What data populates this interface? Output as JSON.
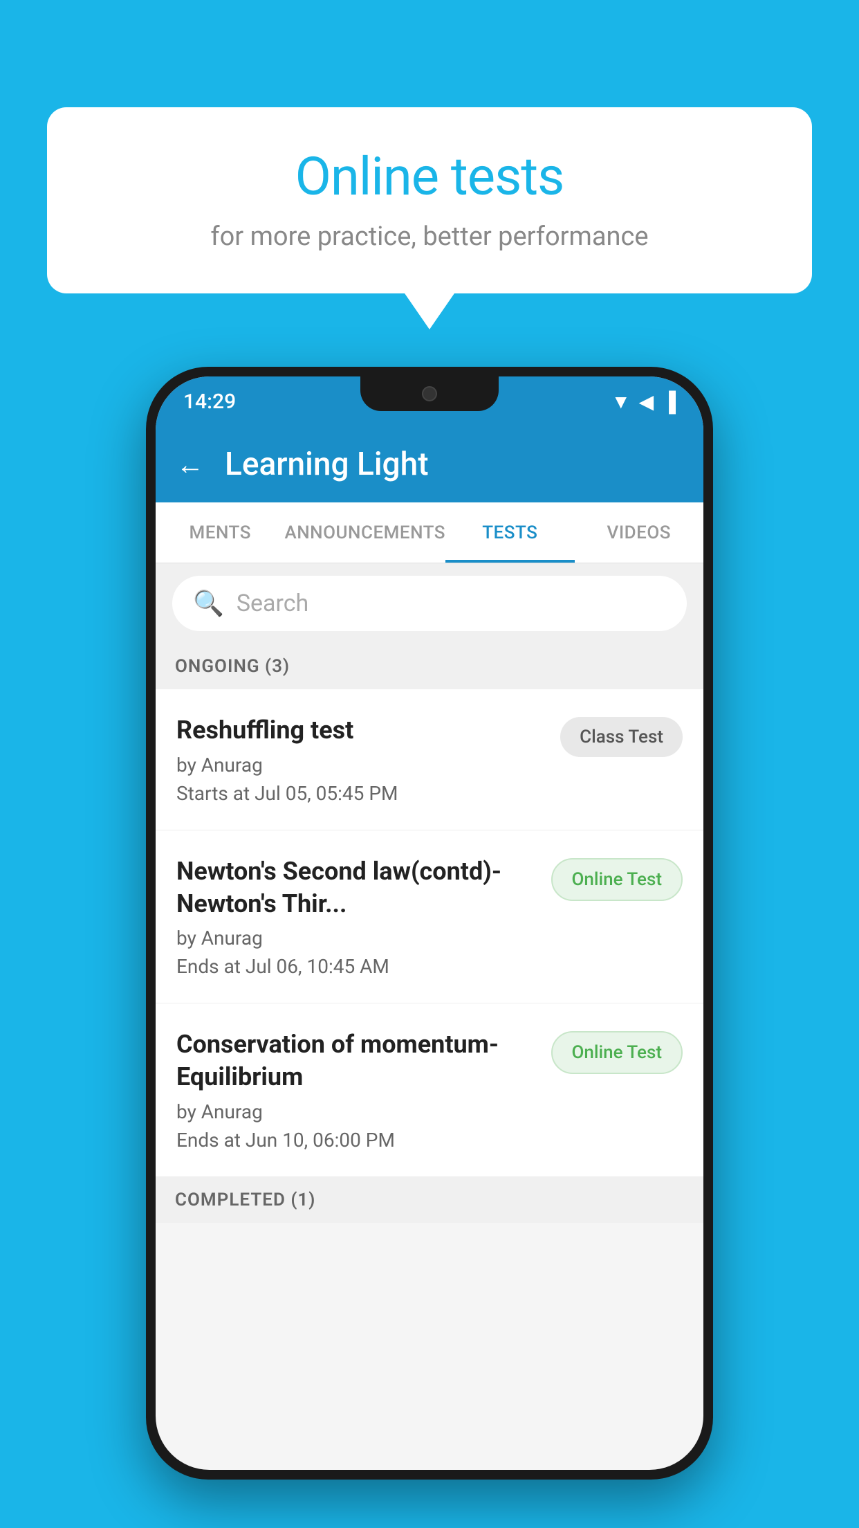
{
  "background_color": "#1AB5E8",
  "bubble": {
    "title": "Online tests",
    "subtitle": "for more practice, better performance"
  },
  "phone": {
    "status_bar": {
      "time": "14:29",
      "icons": [
        "wifi",
        "signal",
        "battery"
      ]
    },
    "app_bar": {
      "title": "Learning Light",
      "back_label": "←"
    },
    "tabs": [
      {
        "label": "MENTS",
        "active": false
      },
      {
        "label": "ANNOUNCEMENTS",
        "active": false
      },
      {
        "label": "TESTS",
        "active": true
      },
      {
        "label": "VIDEOS",
        "active": false
      }
    ],
    "search": {
      "placeholder": "Search"
    },
    "ongoing_section": {
      "label": "ONGOING (3)"
    },
    "tests": [
      {
        "title": "Reshuffling test",
        "author": "by Anurag",
        "date_label": "Starts at  Jul 05, 05:45 PM",
        "badge": "Class Test",
        "badge_type": "class"
      },
      {
        "title": "Newton's Second law(contd)-Newton's Thir...",
        "author": "by Anurag",
        "date_label": "Ends at  Jul 06, 10:45 AM",
        "badge": "Online Test",
        "badge_type": "online"
      },
      {
        "title": "Conservation of momentum-Equilibrium",
        "author": "by Anurag",
        "date_label": "Ends at  Jun 10, 06:00 PM",
        "badge": "Online Test",
        "badge_type": "online"
      }
    ],
    "completed_section": {
      "label": "COMPLETED (1)"
    }
  }
}
